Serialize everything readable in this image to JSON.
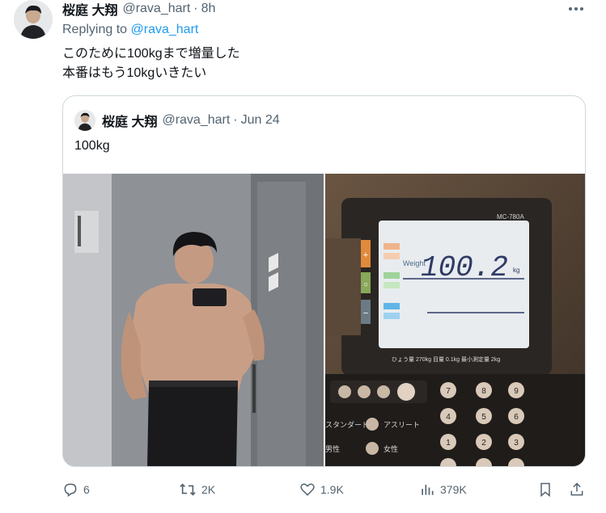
{
  "tweet": {
    "author_name": "桜庭 大翔",
    "handle": "@rava_hart",
    "separator": "·",
    "time": "8h",
    "replying_prefix": "Replying to",
    "replying_to": "@rava_hart",
    "text_lines": [
      "このために100kgまで増量した",
      "本番はもう10kgいきたい"
    ]
  },
  "quote": {
    "author_name": "桜庭 大翔",
    "handle": "@rava_hart",
    "separator": "·",
    "date": "Jun 24",
    "text": "100kg",
    "scale": {
      "model": "MC-780A",
      "weight_label": "Weight",
      "reading": "100.2",
      "unit": "kg",
      "spec_line": "ひょう量 270kg 目量 0.1kg 最小測定量 2kg",
      "mode_standard": "スタンダード",
      "mode_athlete": "アスリート",
      "gender_male": "男性",
      "gender_female": "女性"
    }
  },
  "actions": {
    "reply_count": "6",
    "retweet_count": "2K",
    "like_count": "1.9K",
    "views_count": "379K"
  },
  "icons": [
    "more-icon",
    "reply-icon",
    "retweet-icon",
    "like-icon",
    "views-icon",
    "bookmark-icon",
    "share-icon"
  ],
  "colors": {
    "accent": "#1d9bf0",
    "muted": "#536471",
    "text": "#0f1419",
    "border": "#cfd9de"
  }
}
